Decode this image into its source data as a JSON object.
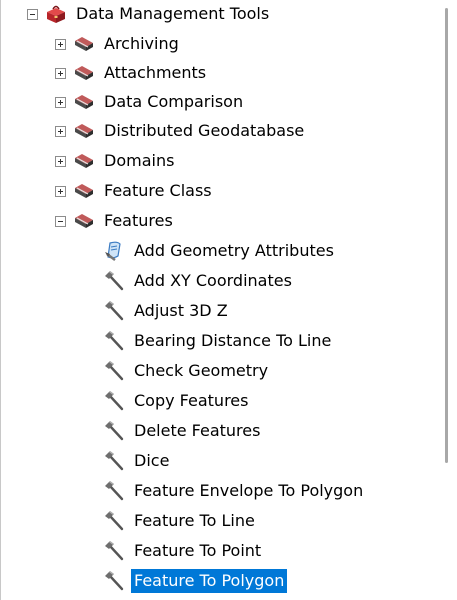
{
  "tree": {
    "root": {
      "label": "Data Management Tools",
      "icon": "toolbox-icon",
      "expander": "collapse"
    },
    "toolsets": [
      {
        "label": "Archiving",
        "icon": "toolset-icon",
        "expander": "expand"
      },
      {
        "label": "Attachments",
        "icon": "toolset-icon",
        "expander": "expand"
      },
      {
        "label": "Data Comparison",
        "icon": "toolset-icon",
        "expander": "expand"
      },
      {
        "label": "Distributed Geodatabase",
        "icon": "toolset-icon",
        "expander": "expand"
      },
      {
        "label": "Domains",
        "icon": "toolset-icon",
        "expander": "expand"
      },
      {
        "label": "Feature Class",
        "icon": "toolset-icon",
        "expander": "expand"
      },
      {
        "label": "Features",
        "icon": "toolset-icon",
        "expander": "collapse"
      }
    ],
    "tools": [
      {
        "label": "Add Geometry Attributes",
        "icon": "script-tool-icon"
      },
      {
        "label": "Add XY Coordinates",
        "icon": "hammer-icon"
      },
      {
        "label": "Adjust 3D Z",
        "icon": "hammer-icon"
      },
      {
        "label": "Bearing Distance To Line",
        "icon": "hammer-icon"
      },
      {
        "label": "Check Geometry",
        "icon": "hammer-icon"
      },
      {
        "label": "Copy Features",
        "icon": "hammer-icon"
      },
      {
        "label": "Delete Features",
        "icon": "hammer-icon"
      },
      {
        "label": "Dice",
        "icon": "hammer-icon"
      },
      {
        "label": "Feature Envelope To Polygon",
        "icon": "hammer-icon"
      },
      {
        "label": "Feature To Line",
        "icon": "hammer-icon"
      },
      {
        "label": "Feature To Point",
        "icon": "hammer-icon"
      },
      {
        "label": "Feature To Polygon",
        "icon": "hammer-icon",
        "selected": true
      }
    ]
  },
  "colors": {
    "selection": "#0078d7",
    "toolbox": "#c0392b"
  }
}
